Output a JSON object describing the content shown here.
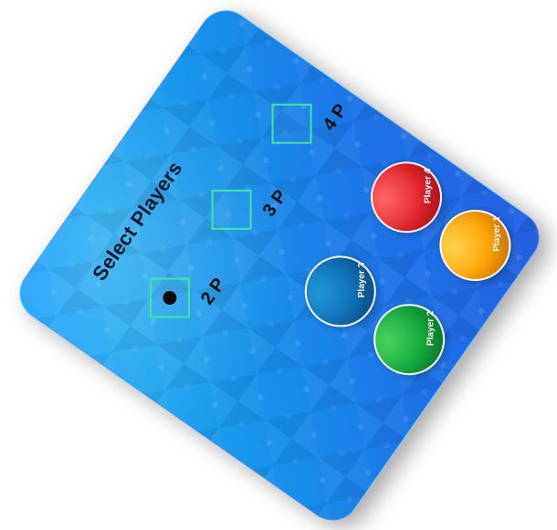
{
  "screen": {
    "title": "Select Players",
    "options": [
      {
        "label": "2 P",
        "selected": true
      },
      {
        "label": "3 P",
        "selected": false
      },
      {
        "label": "4 P",
        "selected": false
      }
    ],
    "players": [
      {
        "label": "Player 3",
        "color": "#0f6db3"
      },
      {
        "label": "Player 4",
        "color": "#e3222a"
      },
      {
        "label": "Player 2",
        "color": "#12a63a"
      },
      {
        "label": "Player 1",
        "color": "#ffa100"
      }
    ]
  }
}
